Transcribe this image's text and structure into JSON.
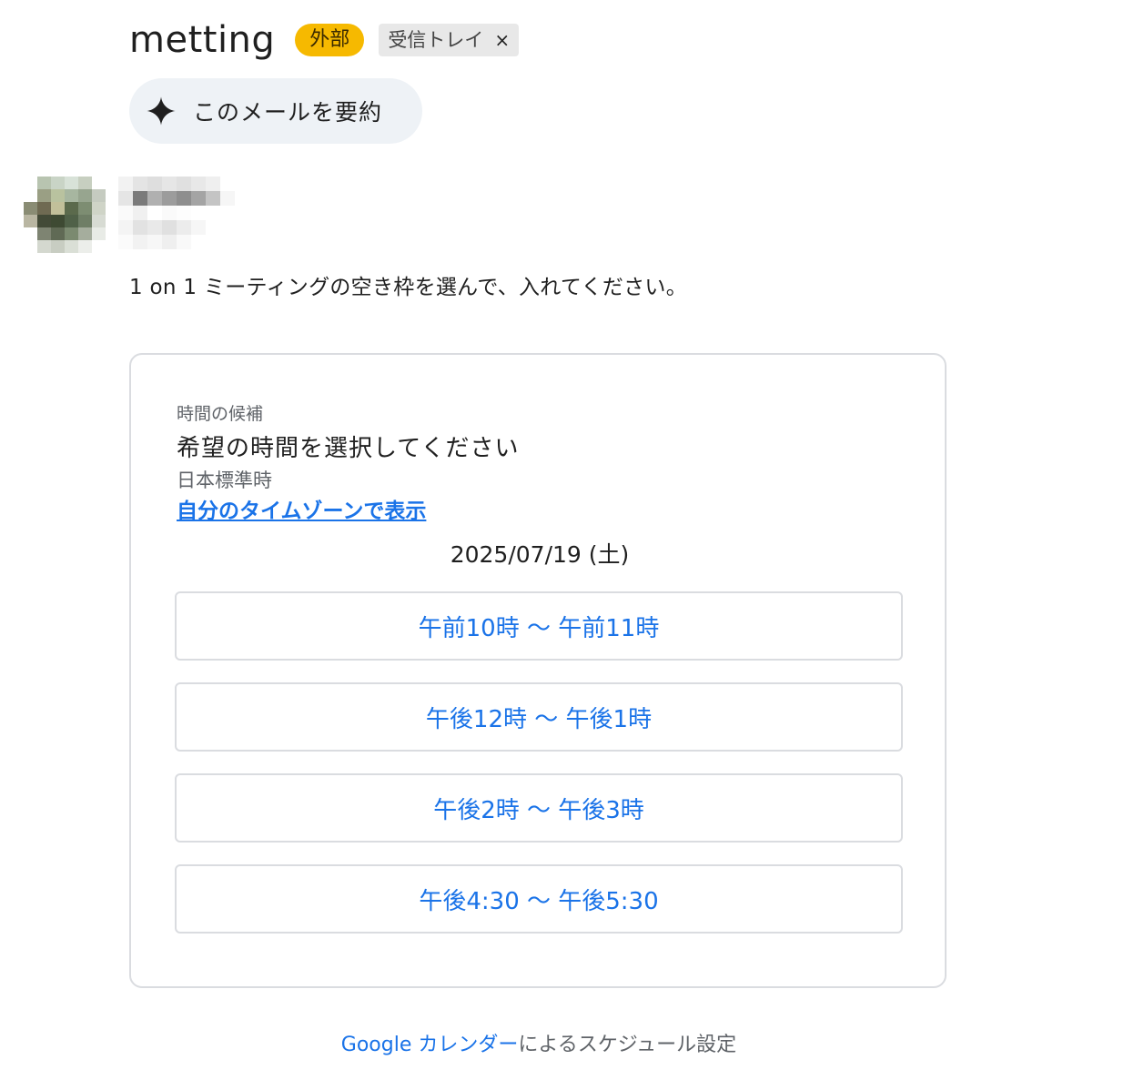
{
  "header": {
    "subject": "metting",
    "label_external": "外部",
    "label_inbox": "受信トレイ",
    "label_inbox_close": "×"
  },
  "summarize": {
    "label": "このメールを要約",
    "icon": "sparkle-icon"
  },
  "message": {
    "body": "1 on 1 ミーティングの空き枠を選んで、入れてください。"
  },
  "card": {
    "section_label": "時間の候補",
    "title": "希望の時間を選択してください",
    "timezone": "日本標準時",
    "timezone_link": "自分のタイムゾーンで表示",
    "date": "2025/07/19 (土)",
    "slots": [
      "午前10時 〜 午前11時",
      "午後12時 〜 午後1時",
      "午後2時 〜 午後3時",
      "午後4:30 〜 午後5:30"
    ]
  },
  "footer": {
    "link": "Google カレンダー",
    "text": "によるスケジュール設定"
  },
  "colors": {
    "accent": "#1a73e8",
    "external_badge": "#f6b900",
    "inbox_badge": "#e8e8e8",
    "summarize_bg": "#eef2f6"
  }
}
